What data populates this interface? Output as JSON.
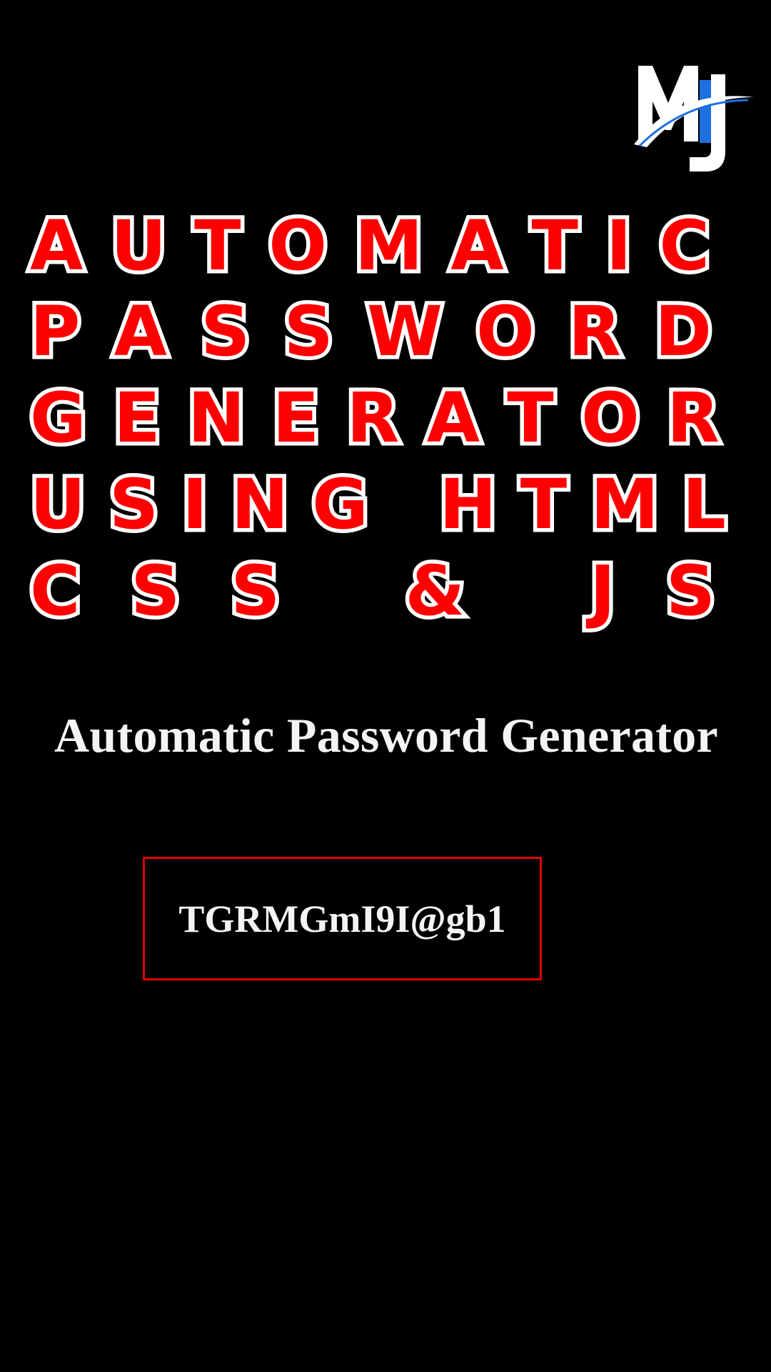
{
  "logo": {
    "text": "MJ",
    "icon": "mj-logo",
    "colors": {
      "primary": "#ffffff",
      "accent": "#1e6fe0"
    }
  },
  "thumbnail": {
    "title_lines": [
      "AUTOMATIC",
      "PASSWORD",
      "GENERATOR",
      "USING HTML",
      "CSS & JS"
    ],
    "colors": {
      "fill": "#ff0000",
      "outline": "#ffffff",
      "background": "#000000"
    }
  },
  "app": {
    "heading": "Automatic Password Generator",
    "password": "TGRMGmI9I@gb1",
    "colors": {
      "box_border": "#e00000",
      "text": "#f4f4f4"
    }
  }
}
